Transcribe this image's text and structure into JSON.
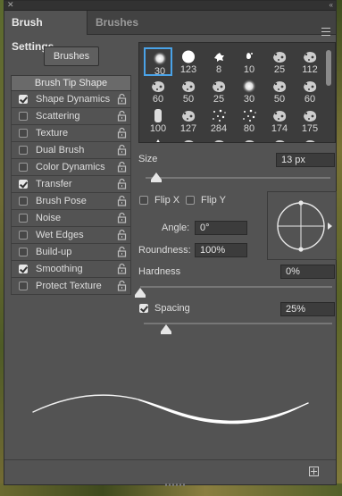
{
  "panel": {
    "close_glyph": "✕",
    "collapse_glyph": "«"
  },
  "tabs": [
    {
      "label": "Brush Settings",
      "active": true
    },
    {
      "label": "Brushes",
      "active": false
    }
  ],
  "brushes_button": "Brushes",
  "brush_tip_shape": "Brush Tip Shape",
  "options": [
    {
      "label": "Shape Dynamics",
      "checked": true
    },
    {
      "label": "Scattering",
      "checked": false
    },
    {
      "label": "Texture",
      "checked": false
    },
    {
      "label": "Dual Brush",
      "checked": false
    },
    {
      "label": "Color Dynamics",
      "checked": false
    },
    {
      "label": "Transfer",
      "checked": true
    },
    {
      "label": "Brush Pose",
      "checked": false
    },
    {
      "label": "Noise",
      "checked": false
    },
    {
      "label": "Wet Edges",
      "checked": false
    },
    {
      "label": "Build-up",
      "checked": false
    },
    {
      "label": "Smoothing",
      "checked": true
    },
    {
      "label": "Protect Texture",
      "checked": false
    }
  ],
  "presets": [
    {
      "size": "30",
      "kind": "soft",
      "selected": true
    },
    {
      "size": "123",
      "kind": "hard"
    },
    {
      "size": "8",
      "kind": "splat"
    },
    {
      "size": "10",
      "kind": "drop"
    },
    {
      "size": "25",
      "kind": "spray"
    },
    {
      "size": "112",
      "kind": "spray"
    },
    {
      "size": "60",
      "kind": "spray"
    },
    {
      "size": "50",
      "kind": "spray"
    },
    {
      "size": "25",
      "kind": "spray"
    },
    {
      "size": "30",
      "kind": "soft"
    },
    {
      "size": "50",
      "kind": "spray"
    },
    {
      "size": "60",
      "kind": "spray"
    },
    {
      "size": "100",
      "kind": "chalk"
    },
    {
      "size": "127",
      "kind": "spray"
    },
    {
      "size": "284",
      "kind": "dots"
    },
    {
      "size": "80",
      "kind": "dots"
    },
    {
      "size": "174",
      "kind": "spray"
    },
    {
      "size": "175",
      "kind": "spray"
    },
    {
      "size": "",
      "kind": "leaf"
    },
    {
      "size": "",
      "kind": "spray"
    },
    {
      "size": "",
      "kind": "spray"
    },
    {
      "size": "",
      "kind": "spray"
    },
    {
      "size": "",
      "kind": "spray"
    },
    {
      "size": "",
      "kind": "spray"
    }
  ],
  "size": {
    "label": "Size",
    "value": "13 px",
    "level_fraction": 0.06
  },
  "flip_x": {
    "label": "Flip X",
    "checked": false
  },
  "flip_y": {
    "label": "Flip Y",
    "checked": false
  },
  "angle": {
    "label": "Angle:",
    "value": "0°"
  },
  "roundness": {
    "label": "Roundness:",
    "value": "100%"
  },
  "hardness": {
    "label": "Hardness",
    "value": "0%",
    "level_fraction": 0.0
  },
  "spacing": {
    "label": "Spacing",
    "value": "25%",
    "checked": true,
    "level_fraction": 0.12
  },
  "colors": {
    "panel": "#535353",
    "selection": "#4aa3e8"
  }
}
